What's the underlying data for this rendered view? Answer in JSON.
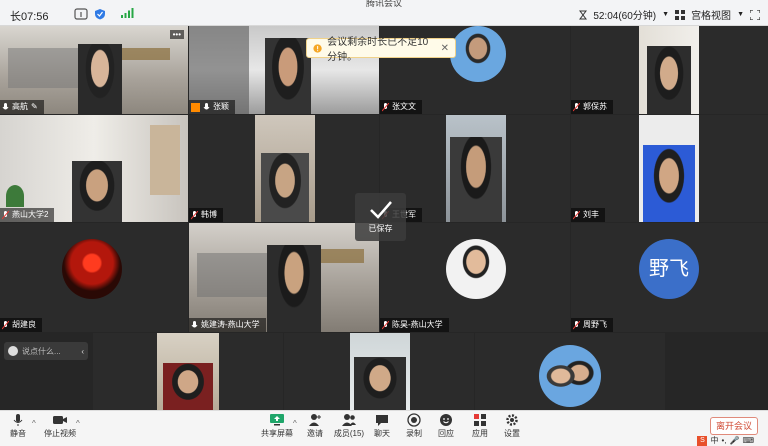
{
  "topbar": {
    "title": "腾讯会议",
    "timer": "长07:56",
    "duration": "52:04(60分钟)",
    "view": "宫格视图"
  },
  "toast": {
    "text": "会议剩余时长已不足10分钟。"
  },
  "saved": {
    "label": "已保存"
  },
  "chat": {
    "placeholder": "说点什么..."
  },
  "tiles": [
    {
      "name": "高航"
    },
    {
      "name": "张颖"
    },
    {
      "name": "张文文"
    },
    {
      "name": "郭保苏"
    },
    {
      "name": "燕山大学2"
    },
    {
      "name": "韩博"
    },
    {
      "name": "王世军"
    },
    {
      "name": "刘丰"
    },
    {
      "name": "胡建良"
    },
    {
      "name": "姚建涛-燕山大学"
    },
    {
      "name": "陈昊-燕山大学"
    },
    {
      "name": "周野飞",
      "avatar_text": "野飞",
      "avatar_color": "#3b6fc9"
    }
  ],
  "toolbar": {
    "mute": "静音",
    "stop_video": "停止视频",
    "share": "共享屏幕",
    "invite": "邀请",
    "members": "成员(15)",
    "chat": "聊天",
    "record": "录制",
    "reaction": "回应",
    "apps": "应用",
    "settings": "设置",
    "leave": "离开会议"
  },
  "ime": {
    "label": "中"
  }
}
